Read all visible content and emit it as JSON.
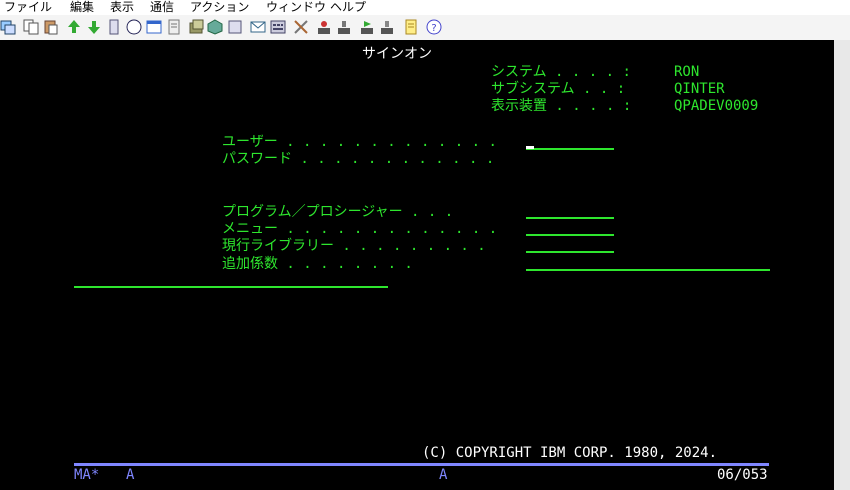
{
  "menubar": {
    "items": [
      "ファイル",
      "編集",
      "表示",
      "通信",
      "アクション",
      "ウィンドウ",
      "ヘルプ"
    ]
  },
  "toolbar": {
    "icons": [
      "copy-screen-icon",
      "copy-icon",
      "paste-icon",
      "send-file-icon",
      "receive-file-icon",
      "print-icon",
      "compass-icon",
      "window-icon",
      "document-icon",
      "macro-icon",
      "cube-icon",
      "record-icon",
      "mail-icon",
      "keypad-icon",
      "tools-icon",
      "upload-user-icon",
      "download-user-icon",
      "play-macro-icon",
      "stop-macro-icon",
      "notes-icon",
      "help-icon"
    ]
  },
  "screen": {
    "title": "サインオン",
    "system_label": "システム . . . . :",
    "system_value": "RON",
    "subsystem_label": "サブシステム . . :",
    "subsystem_value": "QINTER",
    "device_label": "表示装置 . . . . :",
    "device_value": "QPADEV0009",
    "user_label": "ユーザー . . . . . . . . . . . . .",
    "password_label": "パスワード . . . . . . . . . . . .",
    "program_label": "プログラム／プロシージャー . . .",
    "menu_label": "メニュー . . . . . . . . . . . . .",
    "library_label": "現行ライブラリー . . . . . . . . .",
    "additional_label": "追加係数 . . . . . . . .",
    "copyright": "(C) COPYRIGHT IBM CORP. 1980, 2024."
  },
  "oia": {
    "status": "MA*",
    "session": "A",
    "mode": "A",
    "cursor_pos": "06/053"
  },
  "colors": {
    "field_text": "#2ee62e",
    "background": "#000000",
    "oia": "#7f86ff"
  }
}
